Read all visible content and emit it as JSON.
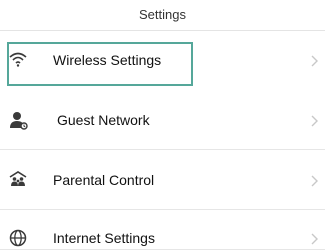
{
  "header": {
    "title": "Settings"
  },
  "items": [
    {
      "label": "Wireless Settings",
      "icon": "wifi-icon",
      "selected": true
    },
    {
      "label": "Guest Network",
      "icon": "guest-user-icon"
    },
    {
      "label": "Parental Control",
      "icon": "parental-control-icon"
    },
    {
      "label": "Internet Settings",
      "icon": "globe-icon"
    }
  ],
  "colors": {
    "highlight_border": "#55a79a",
    "icon": "#3a3a3a",
    "chevron": "#c8c8c8",
    "divider": "#e6e6e6"
  }
}
